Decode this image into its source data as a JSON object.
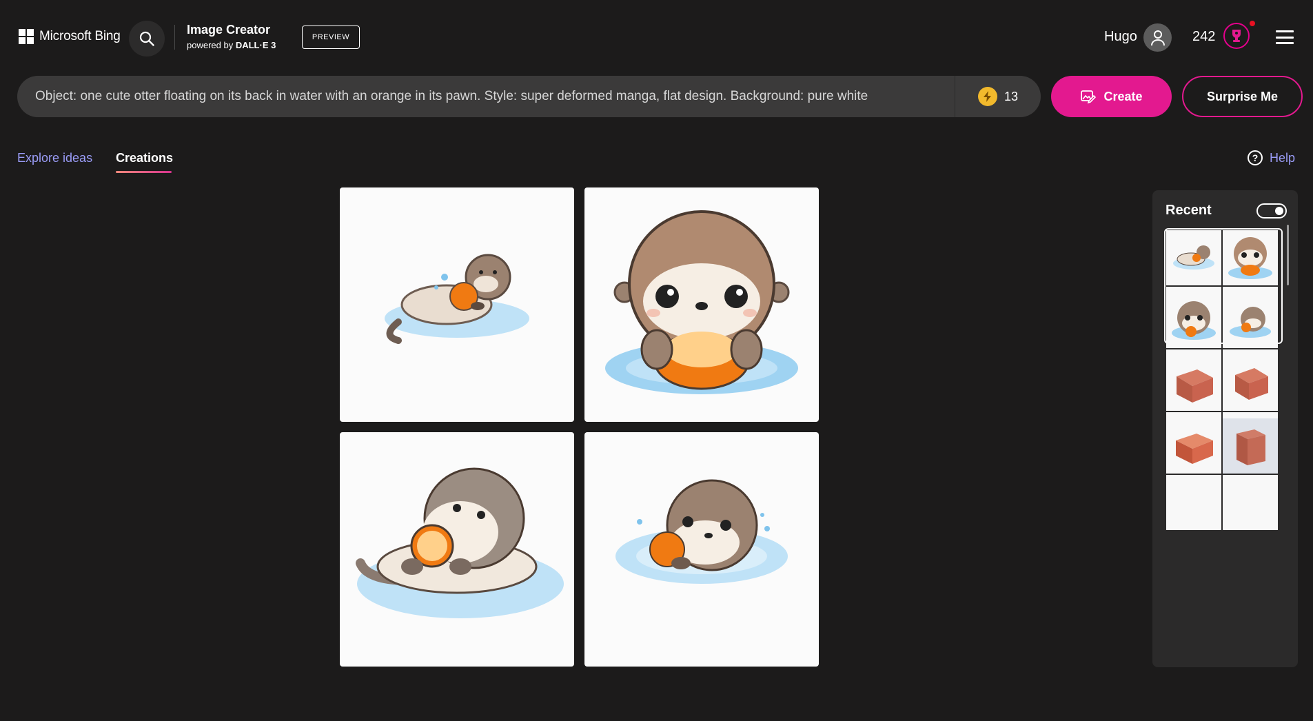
{
  "header": {
    "brand": "Microsoft Bing",
    "app_title": "Image Creator",
    "powered_by_prefix": "powered by ",
    "powered_by_model": "DALL·E 3",
    "preview_label": "PREVIEW",
    "user_name": "Hugo",
    "points": "242"
  },
  "prompt": {
    "text": "Object: one cute otter floating on its back in water with an orange in its pawn. Style: super deformed manga, flat design. Background: pure white",
    "boosts": "13",
    "create_label": "Create",
    "surprise_label": "Surprise Me"
  },
  "tabs": {
    "explore": "Explore ideas",
    "creations": "Creations",
    "active": "Creations"
  },
  "help_label": "Help",
  "recent": {
    "title": "Recent",
    "toggle_on": true,
    "groups": [
      {
        "selected": true,
        "subject": "otter"
      },
      {
        "selected": false,
        "subject": "otter"
      },
      {
        "selected": false,
        "subject": "brick"
      },
      {
        "selected": false,
        "subject": "brick"
      }
    ]
  },
  "colors": {
    "background": "#1c1b1b",
    "accent": "#e3198f",
    "link": "#9a9cf7",
    "otter_brown": "#9b8270",
    "orange": "#f07a12",
    "water": "#a9d6f2",
    "brick": "#c9634f"
  },
  "icons": [
    "windows-logo-icon",
    "search-icon",
    "user-icon",
    "trophy-icon",
    "menu-icon",
    "bolt-icon",
    "create-image-icon",
    "help-icon"
  ]
}
